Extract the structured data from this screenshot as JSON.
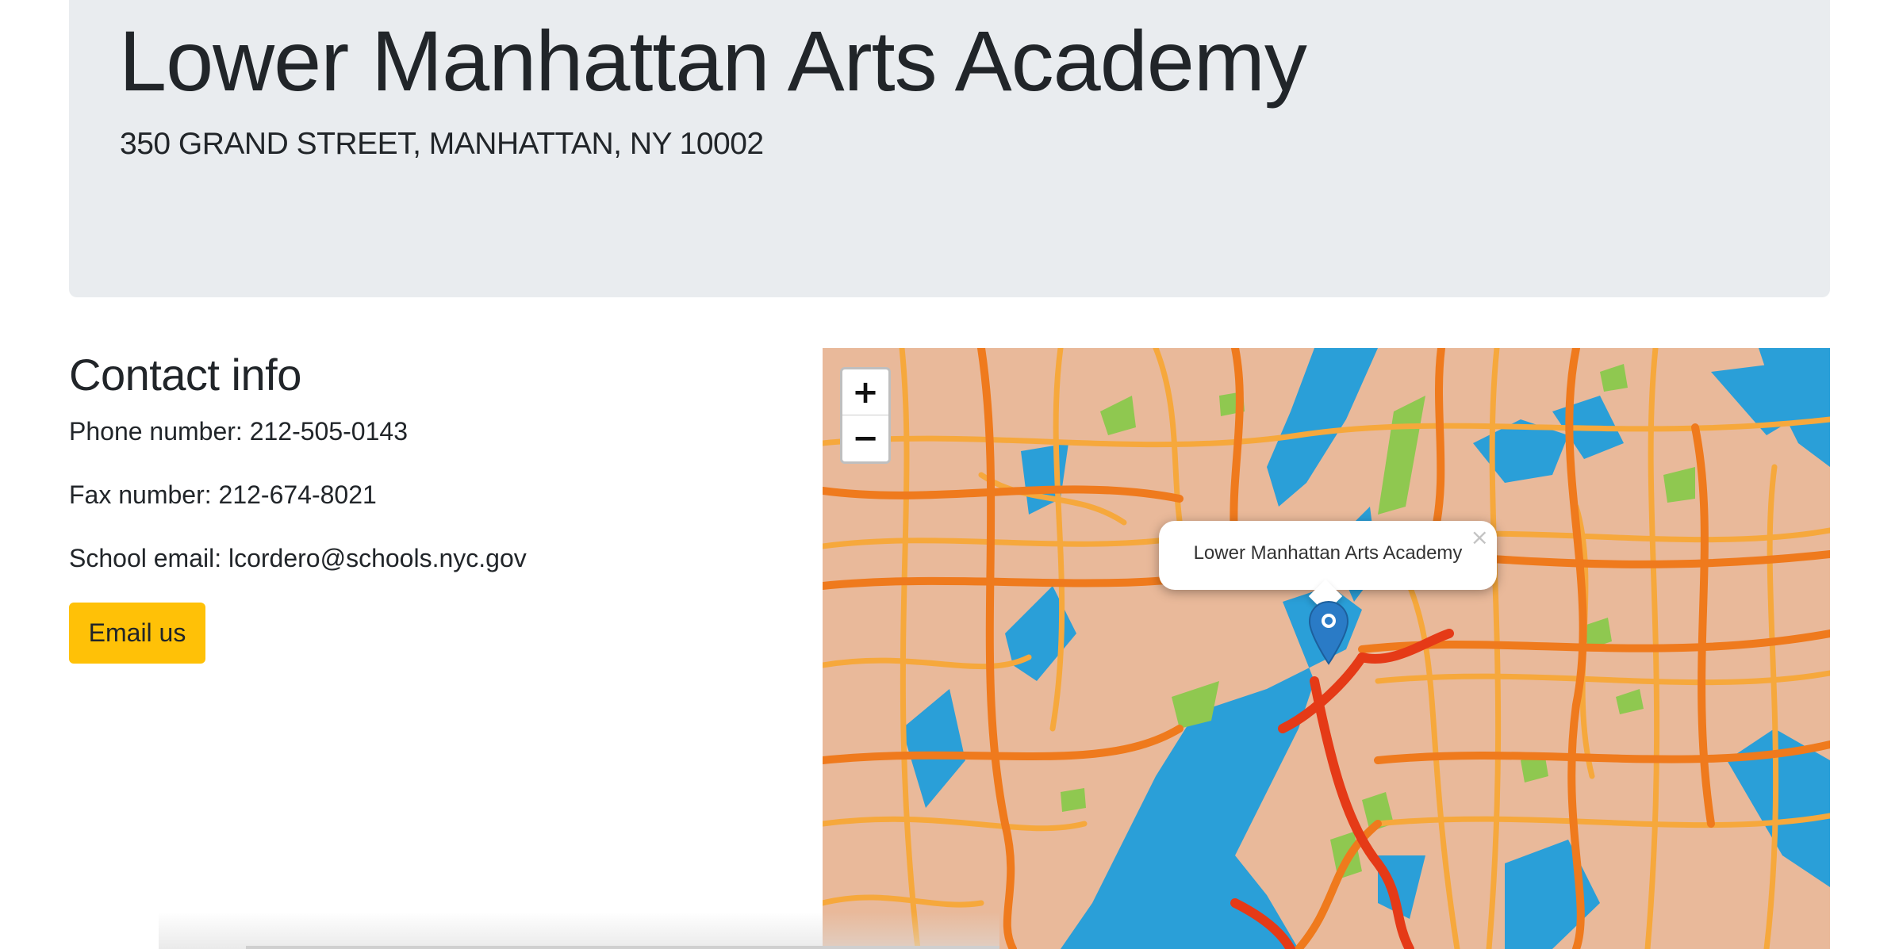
{
  "header": {
    "title": "Lower Manhattan Arts Academy",
    "address": "350 GRAND STREET, MANHATTAN, NY 10002"
  },
  "contact": {
    "heading": "Contact info",
    "phone": "Phone number: 212-505-0143",
    "fax": "Fax number: 212-674-8021",
    "email": "School email: lcordero@schools.nyc.gov",
    "email_button_label": "Email us"
  },
  "map": {
    "zoom_in_label": "+",
    "zoom_out_label": "−",
    "popup_text": "Lower Manhattan Arts Academy",
    "popup_close_label": "×",
    "marker_icon": "map-marker-icon",
    "colors": {
      "land": "#e9b99a",
      "water": "#2a9fd8",
      "park": "#8fc850",
      "road_major": "#ef7a1d",
      "road_minor": "#f6a83c",
      "highway": "#e53a17",
      "marker": "#2a7bc6"
    }
  },
  "theme": {
    "jumbotron_bg": "#e9ecef",
    "button_bg": "#ffc107"
  }
}
